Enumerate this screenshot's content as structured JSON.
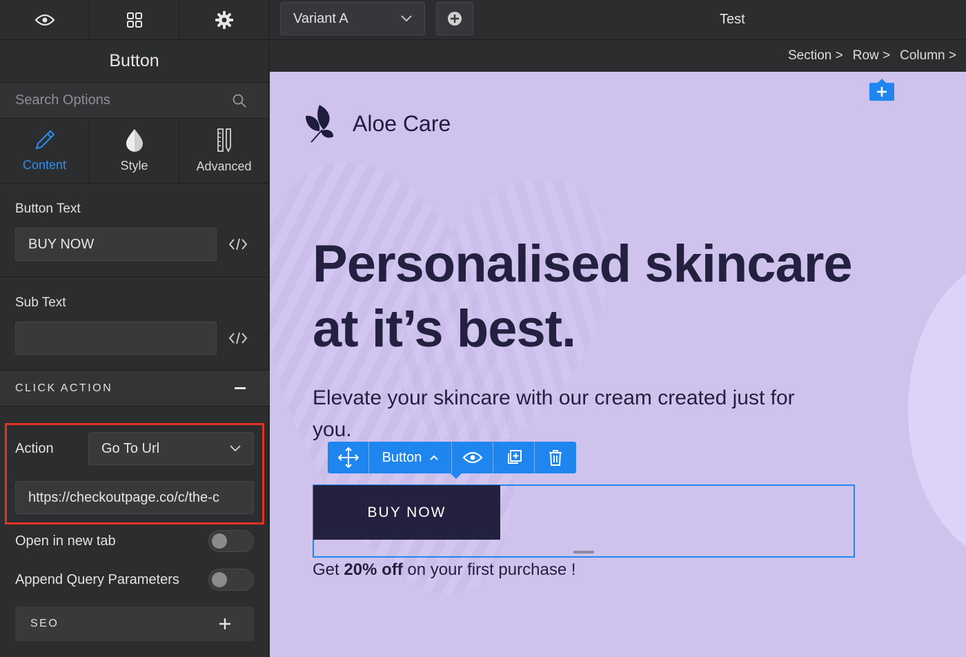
{
  "sidebar": {
    "top_icons": [
      "eye-icon",
      "grid-icon",
      "gear-icon"
    ],
    "title": "Button",
    "search_placeholder": "Search Options",
    "tabs": [
      {
        "label": "Content",
        "icon": "pencil-icon",
        "active": true
      },
      {
        "label": "Style",
        "icon": "drop-icon",
        "active": false
      },
      {
        "label": "Advanced",
        "icon": "ruler-icon",
        "active": false
      }
    ],
    "button_text_label": "Button Text",
    "button_text_value": "BUY NOW",
    "sub_text_label": "Sub Text",
    "sub_text_value": "",
    "click_action_header": "CLICK ACTION",
    "action_label": "Action",
    "action_value": "Go To Url",
    "url_value": "https://checkoutpage.co/c/the-c",
    "open_new_tab_label": "Open in new tab",
    "open_new_tab_on": false,
    "append_query_label": "Append Query Parameters",
    "append_query_on": false,
    "seo_header": "SEO"
  },
  "topbar": {
    "variant": "Variant A",
    "page_name": "Test"
  },
  "breadcrumb": [
    "Section >",
    "Row >",
    "Column >"
  ],
  "page": {
    "brand": "Aloe Care",
    "headline_line1": "Personalised skincare",
    "headline_line2": "at it’s best.",
    "subhead": "Elevate your skincare with our cream created just for you.",
    "toolbar_label": "Button",
    "button_text": "BUY NOW",
    "offer_pre": "Get ",
    "offer_bold": "20% off",
    "offer_post": " on your first purchase !"
  },
  "colors": {
    "accent": "#1f86f0",
    "highlight": "#e3321f",
    "canvas_bg": "#cfc3ee",
    "dark_text": "#23213f"
  }
}
